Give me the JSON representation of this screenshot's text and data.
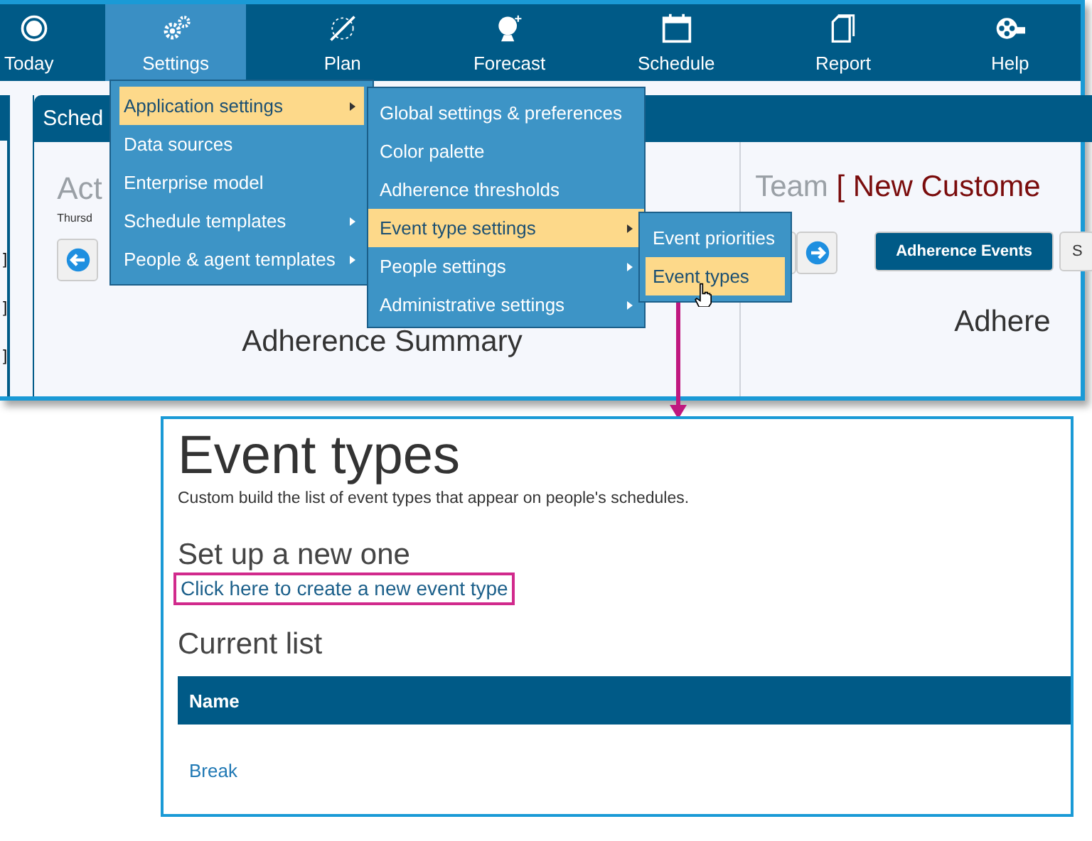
{
  "top_window": {
    "nav": [
      {
        "label": "Today",
        "selected": false
      },
      {
        "label": "Settings",
        "selected": true
      },
      {
        "label": "Plan",
        "selected": false
      },
      {
        "label": "Forecast",
        "selected": false
      },
      {
        "label": "Schedule",
        "selected": false
      },
      {
        "label": "Report",
        "selected": false
      },
      {
        "label": "Help",
        "selected": false
      }
    ],
    "sidebar_marks": [
      "]",
      "]",
      "]"
    ],
    "panel": {
      "title": "Sched",
      "heading": "Act",
      "date": "Thursd",
      "summary_title": "Adherence Summary"
    },
    "team_panel": {
      "heading_prefix": "Team",
      "heading_name": "[ New Custome",
      "tabs": [
        {
          "label": "Adherence Events",
          "selected": true
        },
        {
          "label": "S",
          "selected": false
        }
      ],
      "summary_title": "Adhere"
    },
    "menus": [
      {
        "items": [
          {
            "label": "Application settings",
            "selected": true,
            "submenu": true
          },
          {
            "label": "Data sources",
            "selected": false,
            "submenu": false
          },
          {
            "label": "Enterprise model",
            "selected": false,
            "submenu": false
          },
          {
            "label": "Schedule templates",
            "selected": false,
            "submenu": true
          },
          {
            "label": "People & agent templates",
            "selected": false,
            "submenu": true
          }
        ]
      },
      {
        "items": [
          {
            "label": "Global settings & preferences",
            "selected": false,
            "submenu": false
          },
          {
            "label": "Color palette",
            "selected": false,
            "submenu": false
          },
          {
            "label": "Adherence thresholds",
            "selected": false,
            "submenu": false
          },
          {
            "label": "Event type settings",
            "selected": true,
            "submenu": true
          },
          {
            "label": "People settings",
            "selected": false,
            "submenu": true
          },
          {
            "label": "Administrative settings",
            "selected": false,
            "submenu": true
          }
        ]
      },
      {
        "items": [
          {
            "label": "Event priorities",
            "selected": false,
            "submenu": false
          },
          {
            "label": "Event types",
            "selected": true,
            "submenu": false
          }
        ]
      }
    ]
  },
  "detail_window": {
    "title": "Event types",
    "description": "Custom build the list of event types that appear on people's schedules.",
    "setup_heading": "Set up a new one",
    "create_link": "Click here to create a new event type",
    "list_heading": "Current list",
    "columns": [
      "Name"
    ],
    "rows": [
      [
        "Break"
      ]
    ]
  }
}
